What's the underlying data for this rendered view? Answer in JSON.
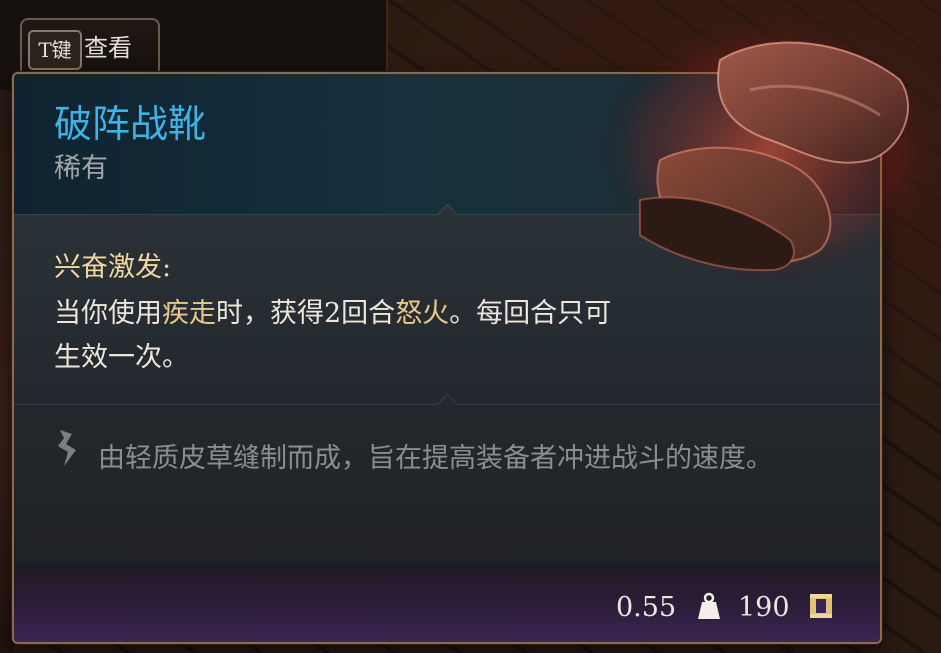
{
  "hint": {
    "key": "T键",
    "label": "查看"
  },
  "item": {
    "name": "破阵战靴",
    "rarity": "稀有",
    "effect_title": "兴奋激发:",
    "effect_desc_parts": [
      "当你使用",
      "疾走",
      "时，获得2回合",
      "怒火",
      "。每回合只可生效一次。"
    ],
    "flavor_text": "由轻质皮草缝制而成，旨在提高装备者冲进战斗的速度。",
    "weight": "0.55",
    "price": "190"
  },
  "colors": {
    "name": "#3fb2e6",
    "rarity": "#a2a6a8",
    "effect_title": "#f0d8a0",
    "keyword": "#e8c98a",
    "flavor": "#8b8e90",
    "border": "#8c6a4a"
  },
  "icons": {
    "quill": "quill-icon",
    "weight": "weight-icon",
    "gold": "gold-coin-icon",
    "item": "boots-item-icon"
  }
}
